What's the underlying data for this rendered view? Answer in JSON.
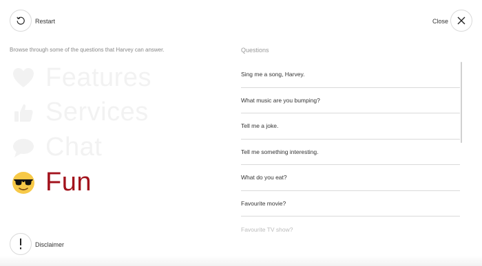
{
  "header": {
    "restart_label": "Restart",
    "close_label": "Close"
  },
  "intro_text": "Browse through some of the questions that Harvey can answer.",
  "categories": [
    {
      "name": "Features",
      "icon": "heart-icon",
      "state": "inactive"
    },
    {
      "name": "Services",
      "icon": "thumbs-up-icon",
      "state": "inactive"
    },
    {
      "name": "Chat",
      "icon": "chat-bubble-icon",
      "state": "inactive"
    },
    {
      "name": "Fun",
      "icon": "sunglasses-face-icon",
      "state": "active"
    }
  ],
  "questions_heading": "Questions",
  "questions": [
    "Sing me a song, Harvey.",
    "What music are you bumping?",
    "Tell me a joke.",
    "Tell me something interesting.",
    "What do you eat?",
    "Favourite movie?",
    "Favourite TV show?"
  ],
  "footer": {
    "disclaimer_label": "Disclaimer"
  },
  "colors": {
    "active_category": "#a2121c",
    "border": "#d9d9d9"
  }
}
